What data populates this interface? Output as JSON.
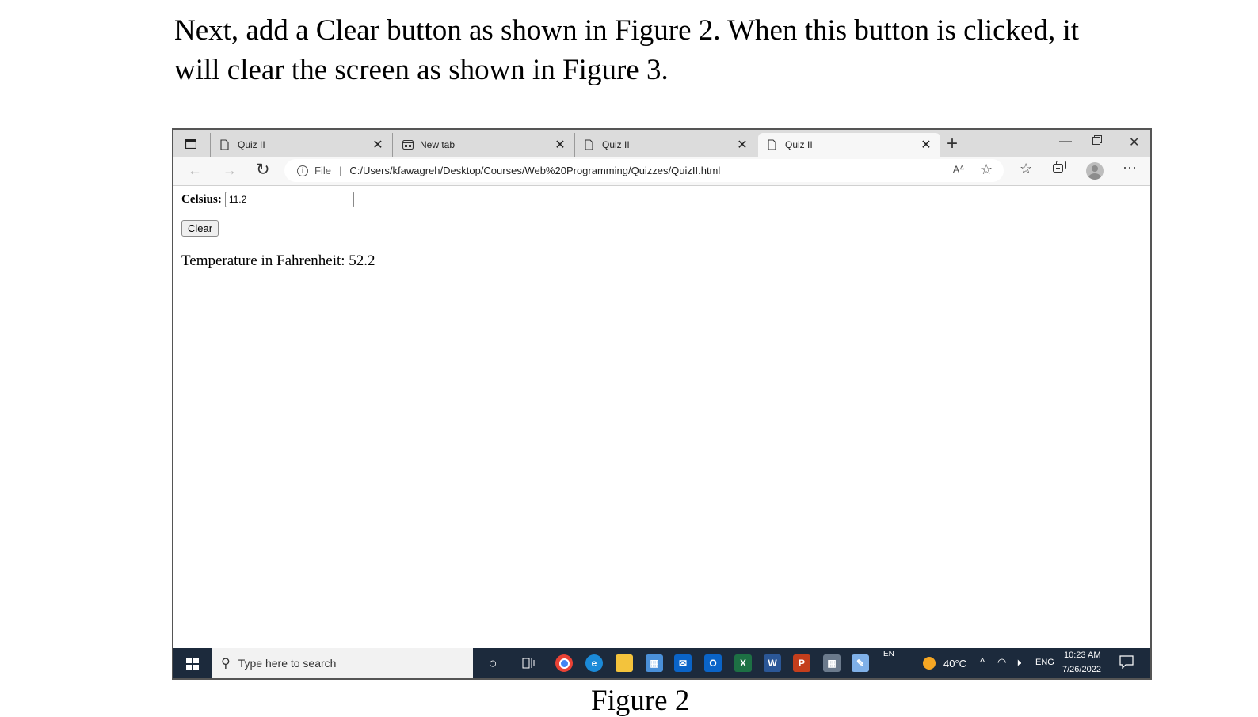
{
  "document": {
    "paragraph": "Next, add a Clear button as shown in Figure 2. When this button is clicked, it will clear the screen as shown in Figure 3.",
    "caption": "Figure 2"
  },
  "browser": {
    "tabs": [
      {
        "title": "Quiz II",
        "icon": "file-icon",
        "active": false
      },
      {
        "title": "New tab",
        "icon": "new-tab-icon",
        "active": false
      },
      {
        "title": "Quiz II",
        "icon": "file-icon",
        "active": false
      },
      {
        "title": "Quiz II",
        "icon": "file-icon",
        "active": true
      }
    ],
    "tab_close_glyph": "✕",
    "new_tab_glyph": "+",
    "address": {
      "protocol_label": "File",
      "separator": "|",
      "url": "C:/Users/kfawagreh/Desktop/Courses/Web%20Programming/Quizzes/QuizII.html"
    }
  },
  "page": {
    "celsius_label": "Celsius:",
    "celsius_value": "11.2",
    "clear_button_label": "Clear",
    "result_text": "Temperature in Fahrenheit: 52.2"
  },
  "taskbar": {
    "search_placeholder": "Type here to search",
    "lang_indicator": "EN",
    "weather": "40°C",
    "language": "ENG",
    "time": "10:23 AM",
    "date": "7/26/2022"
  },
  "colors": {
    "taskbar_bg": "#1c2a3c",
    "tabbar_bg": "#dcdcdc",
    "excel": "#1d7044",
    "word": "#2b5797",
    "powerpoint": "#c43e1c",
    "outlook": "#0a64c8"
  }
}
